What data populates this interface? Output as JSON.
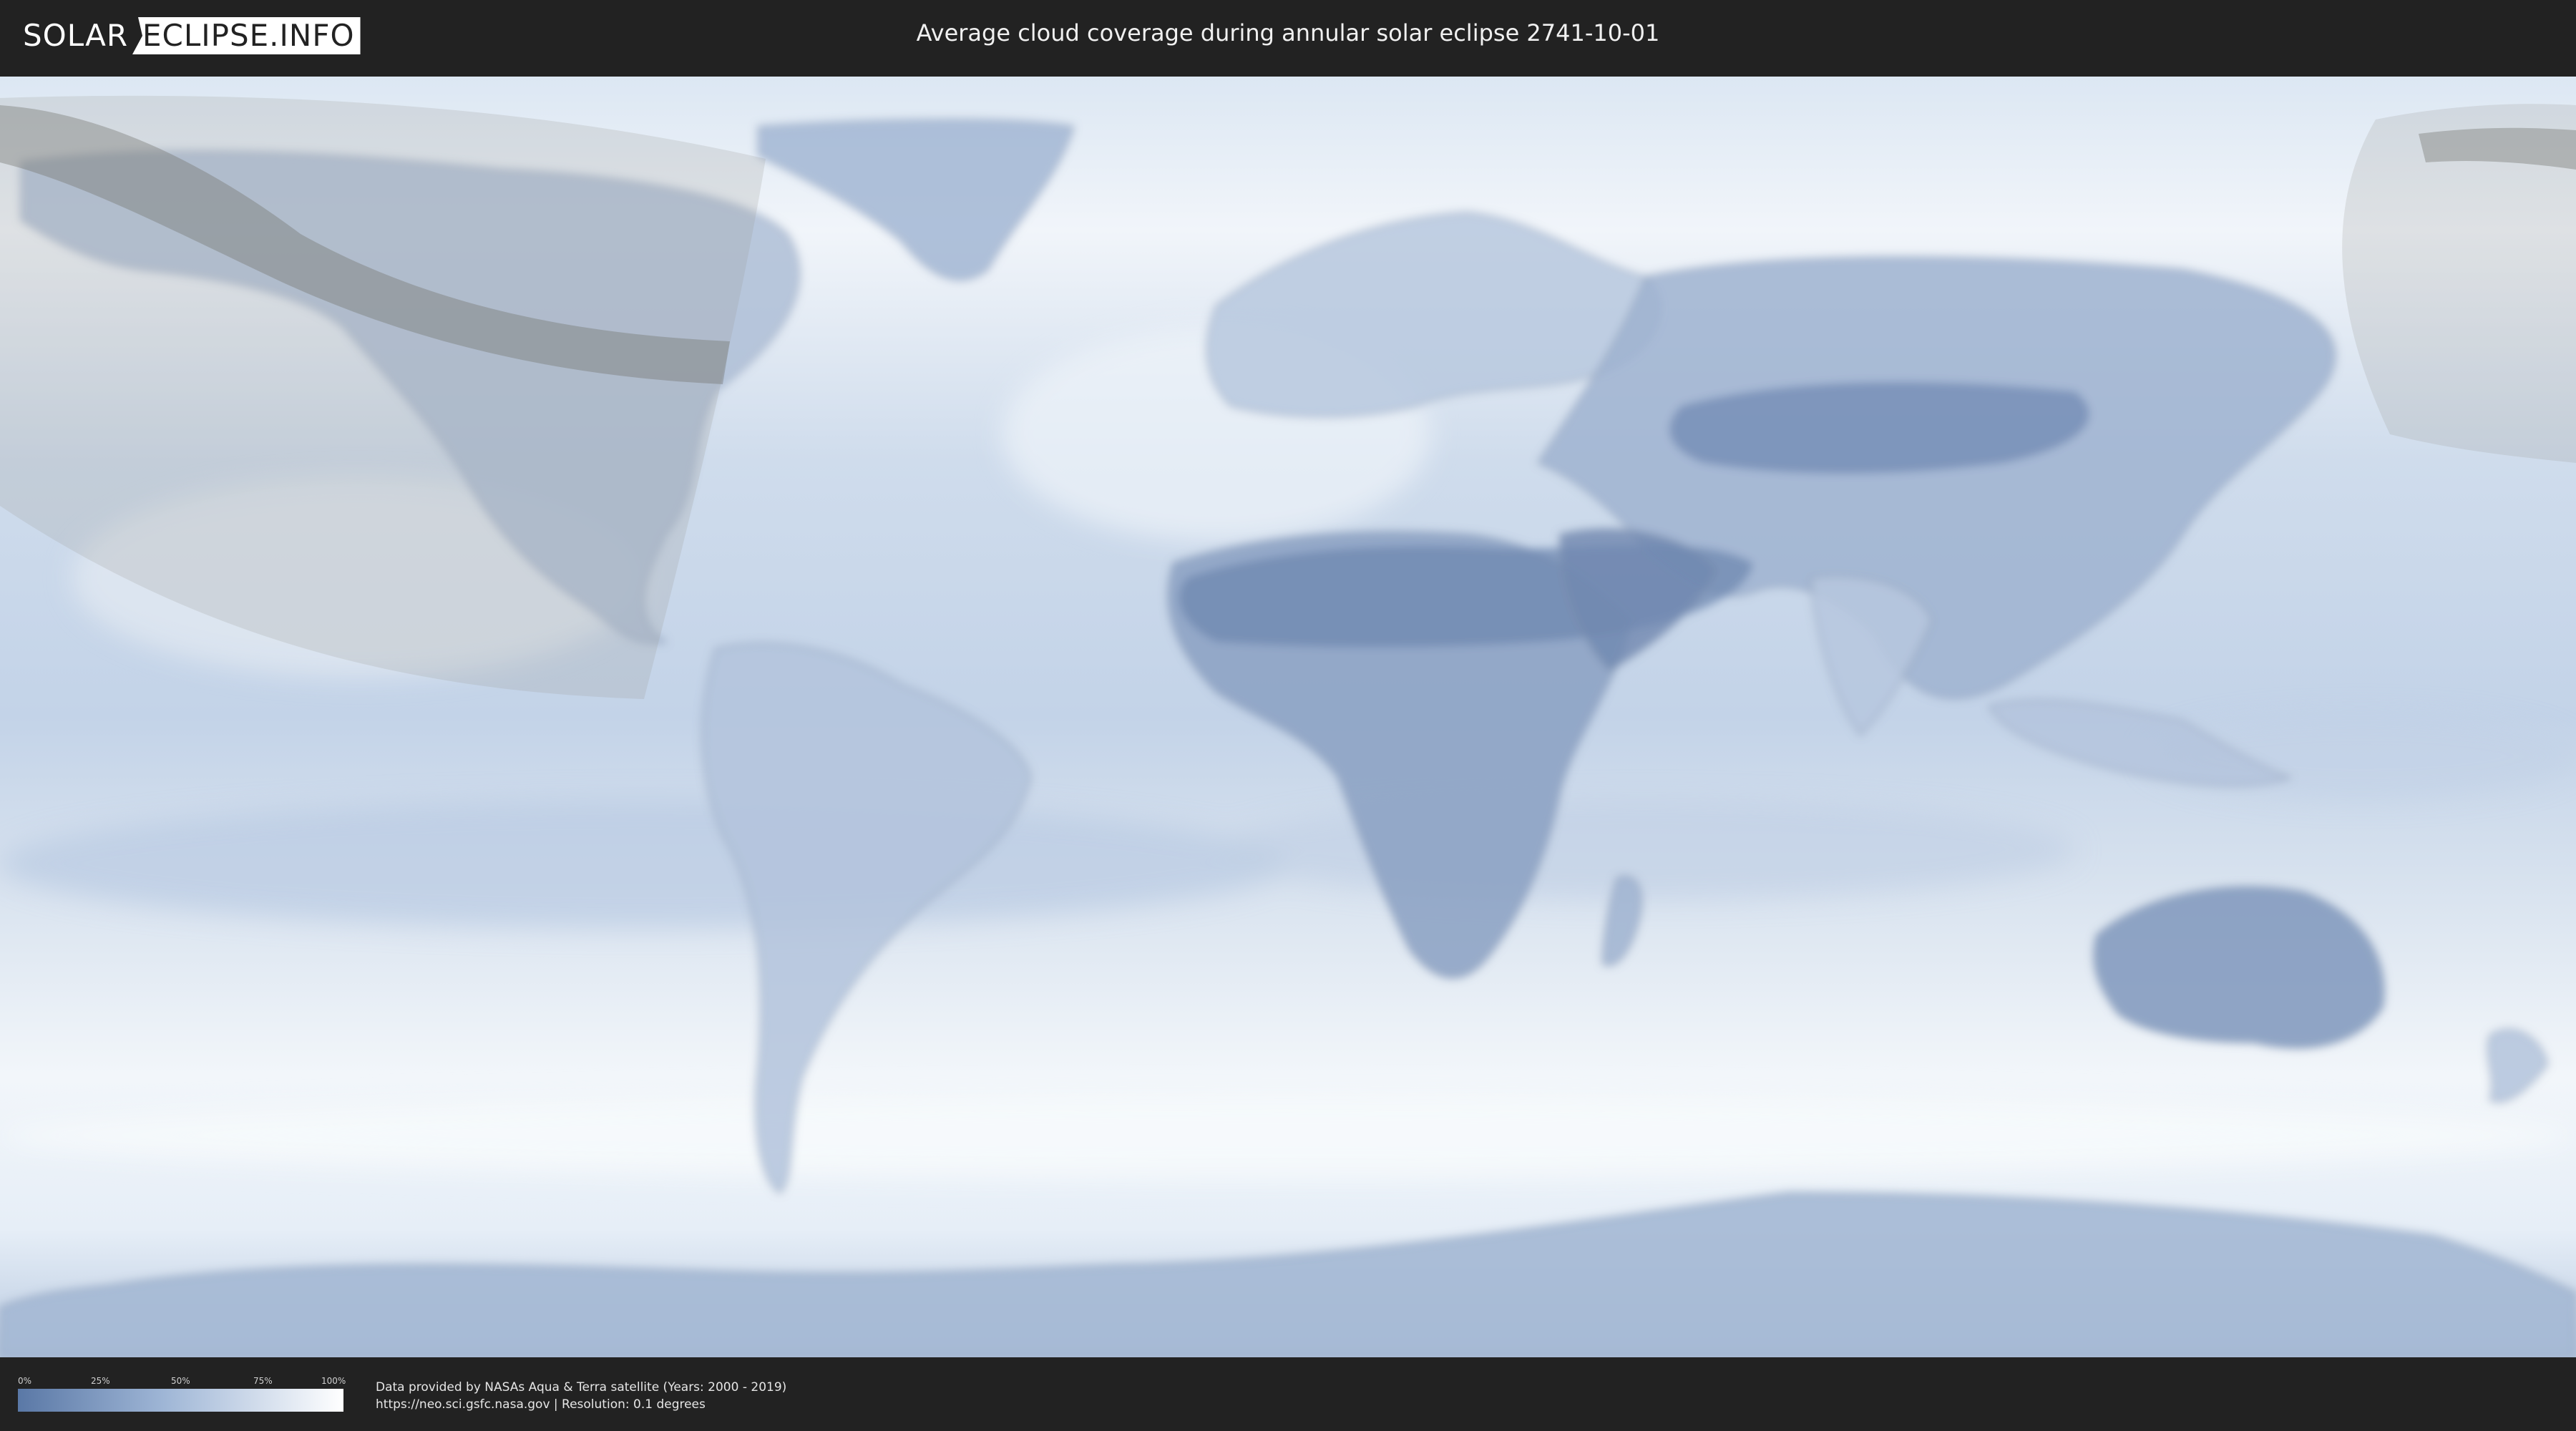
{
  "header": {
    "logo_part1": "SOLAR",
    "logo_part2": "ECLIPSE.INFO",
    "title": "Average cloud coverage during annular solar eclipse 2741-10-01"
  },
  "legend": {
    "ticks": [
      "0%",
      "25%",
      "50%",
      "75%",
      "100%"
    ],
    "colors": {
      "low": "#5a78a6",
      "mid": "#9fb6d6",
      "high": "#ffffff"
    }
  },
  "footer": {
    "credit_line1": "Data provided by NASAs Aqua & Terra satellite (Years: 2000 - 2019)",
    "credit_line2": "https://neo.sci.gsfc.nasa.gov | Resolution: 0.1 degrees"
  },
  "map": {
    "type": "world cloud coverage map",
    "eclipse_path": "annular eclipse path across North Pacific, Canada and Northeast Asia"
  }
}
